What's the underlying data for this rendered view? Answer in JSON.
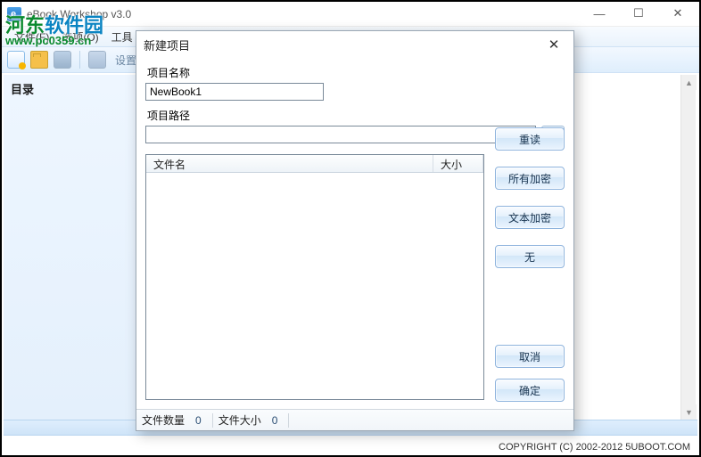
{
  "window": {
    "title": "eBook Workshop v3.0"
  },
  "menubar": {
    "file": "文件(F)",
    "options": "选项(O)",
    "tools": "工具"
  },
  "toolbar": {
    "settings_label": "设置"
  },
  "sidebar": {
    "heading": "目录"
  },
  "footer": {
    "copyright": "COPYRIGHT (C) 2002-2012 5UBOOT.COM"
  },
  "watermark": {
    "line1_a": "河东",
    "line1_b": "软件园",
    "line2": "www.pc0359.cn"
  },
  "dialog": {
    "title": "新建项目",
    "name_label": "项目名称",
    "name_value": "NewBook1",
    "path_label": "项目路径",
    "path_value": "",
    "browse": "...",
    "buttons": {
      "reread": "重读",
      "encrypt_all": "所有加密",
      "encrypt_text": "文本加密",
      "none": "无",
      "cancel": "取消",
      "ok": "确定"
    },
    "filelist": {
      "col_filename": "文件名",
      "col_size": "大小"
    },
    "status": {
      "filecount_label": "文件数量",
      "filecount_value": "0",
      "filesize_label": "文件大小",
      "filesize_value": "0"
    }
  }
}
